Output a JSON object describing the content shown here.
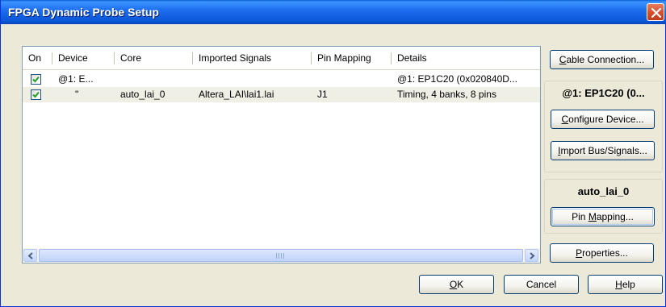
{
  "window": {
    "title": "FPGA Dynamic Probe Setup"
  },
  "table": {
    "columns": [
      "On",
      "Device",
      "Core",
      "Imported Signals",
      "Pin Mapping",
      "Details"
    ],
    "rows": [
      {
        "on": true,
        "device": "@1: E...",
        "core": "",
        "imported_signals": "",
        "pin_mapping": "",
        "details": "@1: EP1C20 (0x020840D..."
      },
      {
        "on": true,
        "device": "\"",
        "core": "auto_lai_0",
        "imported_signals": "Altera_LAI\\lai1.lai",
        "pin_mapping": "J1",
        "details": "Timing, 4 banks, 8 pins"
      }
    ]
  },
  "sidebar": {
    "cable_connection": {
      "pre": "",
      "key": "C",
      "post": "able Connection..."
    },
    "device_group_title": "@1: EP1C20 (0...",
    "configure_device": {
      "pre": "",
      "key": "C",
      "post": "onfigure Device..."
    },
    "import_bus_signals": {
      "pre": "",
      "key": "I",
      "post": "mport Bus/Signals..."
    },
    "core_group_title": "auto_lai_0",
    "pin_mapping": {
      "pre": "Pin ",
      "key": "M",
      "post": "apping..."
    },
    "properties": {
      "pre": "",
      "key": "P",
      "post": "roperties..."
    }
  },
  "footer": {
    "ok": {
      "pre": "",
      "key": "O",
      "post": "K"
    },
    "cancel": "Cancel",
    "help": {
      "pre": "",
      "key": "H",
      "post": "elp"
    }
  },
  "colors": {
    "titlebar": "#0a56d6",
    "dialog_bg": "#ece9d8",
    "selected_row": "#f0efe5",
    "button_border": "#003c74"
  },
  "icons": {
    "close": "close-icon",
    "checkbox": "checkmark-icon",
    "scroll_left": "arrow-left-icon",
    "scroll_right": "arrow-right-icon"
  }
}
